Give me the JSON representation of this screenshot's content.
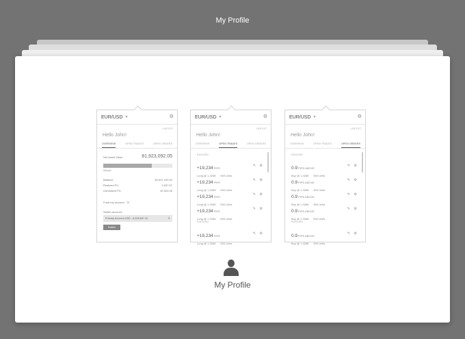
{
  "page": {
    "title": "My Profile"
  },
  "profile": {
    "title": "My Profile"
  },
  "cards": [
    {
      "pair": "EUR/USD",
      "meta": "LIVE EXT",
      "greeting": "Hello John!",
      "tabs": [
        "OVERVIEW",
        "OPEN TRADES",
        "OPEN ORDERS"
      ],
      "active_tab": 0,
      "overview": {
        "nav_label": "Net Asset Value",
        "nav_value": "81,923,092.05",
        "margin_label": "Margin",
        "margin_fill": 0.7,
        "stats": [
          {
            "label": "Balance",
            "value": "80,637,232.54"
          },
          {
            "label": "Realized P/L",
            "value": "2,937.67"
          },
          {
            "label": "Unrealized P/L",
            "value": "49,320.45"
          }
        ],
        "fund_label": "Fund my account",
        "switch_label": "Switch account",
        "switch_value": "Primary Account USD - 8,928,657.10",
        "switch_button": "Switch"
      }
    },
    {
      "pair": "EUR/USD",
      "meta": "LIVE EXT",
      "greeting": "Hello John!",
      "tabs": [
        "OVERVIEW",
        "OPEN TRADES",
        "OPEN ORDERS"
      ],
      "active_tab": 1,
      "groups": [
        {
          "name": "EAD/USD",
          "rows": [
            {
              "value": "+19,234",
              "unit": "PIPS",
              "sub": "Long @ 1.3268",
              "units": "500 Units"
            },
            {
              "value": "+19,234",
              "unit": "PIPS",
              "sub": "Long @ 1.3268",
              "units": "500 Units"
            },
            {
              "value": "+19,234",
              "unit": "PIPS",
              "sub": "Long @ 1.3268",
              "units": "500 Units"
            },
            {
              "value": "+19,234",
              "unit": "PIPS",
              "sub": "Long @ 1.3268",
              "units": "500 Units"
            }
          ]
        },
        {
          "name": "EUR/USD",
          "rows": [
            {
              "value": "+19,234",
              "unit": "PIPS",
              "sub": "Long @ 1.3268",
              "units": "500 Units"
            }
          ]
        }
      ]
    },
    {
      "pair": "EUR/USD",
      "meta": "LIVE EXT",
      "greeting": "Hello John!",
      "tabs": [
        "OVERVIEW",
        "OPEN TRADES",
        "OPEN ORDERS"
      ],
      "active_tab": 2,
      "groups": [
        {
          "name": "EAD/USD",
          "rows": [
            {
              "value": "0.9",
              "unit": "PIPS ABOVE",
              "sub": "Buy @ 1.3268",
              "units": "500 Units"
            },
            {
              "value": "0.9",
              "unit": "PIPS ABOVE",
              "sub": "Buy @ 1.3268",
              "units": "500 Units"
            },
            {
              "value": "0.9",
              "unit": "PIPS ABOVE",
              "sub": "Buy @ 1.3268",
              "units": "500 Units"
            },
            {
              "value": "0.9",
              "unit": "PIPS ABOVE",
              "sub": "Buy @ 1.3268",
              "units": "500 Units"
            }
          ]
        },
        {
          "name": "EUR/USD",
          "rows": [
            {
              "value": "0.9",
              "unit": "PIPS ABOVE",
              "sub": "Buy @ 1.3268",
              "units": "500 Units"
            }
          ]
        }
      ]
    }
  ],
  "icons": {
    "gear": "gear-icon",
    "pencil": "pencil-icon",
    "cog": "cog-icon",
    "chevron": "chevron-down-icon",
    "avatar": "user-avatar-icon",
    "external": "external-link-icon"
  },
  "colors": {
    "background": "#737373",
    "panel": "#ffffff",
    "bar_fill": "#a8a8a8",
    "button": "#888888"
  }
}
